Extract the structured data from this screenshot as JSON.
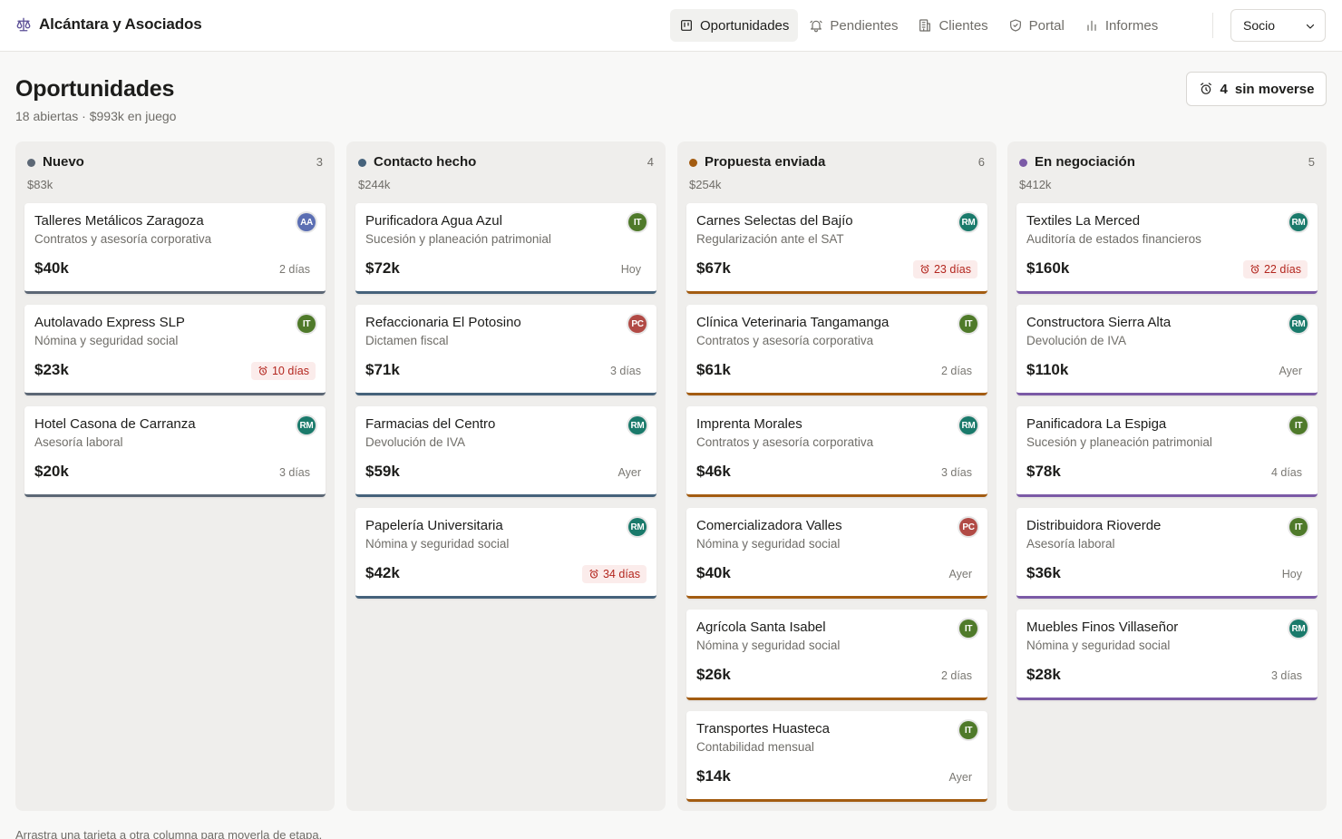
{
  "brand": {
    "name": "Alcántara y Asociados",
    "icon": "scales-icon"
  },
  "nav": [
    {
      "label": "Oportunidades",
      "icon": "kanban-icon",
      "active": true
    },
    {
      "label": "Pendientes",
      "icon": "bell-icon",
      "active": false
    },
    {
      "label": "Clientes",
      "icon": "building-icon",
      "active": false
    },
    {
      "label": "Portal",
      "icon": "shield-icon",
      "active": false
    },
    {
      "label": "Informes",
      "icon": "bar-chart-icon",
      "active": false
    }
  ],
  "role_select": {
    "value": "Socio"
  },
  "page": {
    "title": "Oportunidades",
    "subtitle": "18 abiertas · $993k en juego",
    "stale_button": {
      "count": "4",
      "label": "sin moverse"
    }
  },
  "colors": {
    "nuevo": "#5c6775",
    "contacto": "#45627b",
    "propuesta": "#a35c11",
    "negociacion": "#7b5aa6",
    "stale_bg": "#fbeceb",
    "stale_text": "#b3261e"
  },
  "avatars": {
    "AA": "#5b6eb3",
    "IT": "#4f7a2a",
    "PC": "#b14a45",
    "RM": "#1a7a6b"
  },
  "columns": [
    {
      "title": "Nuevo",
      "count": "3",
      "total": "$83k",
      "color": "#5c6775",
      "cards": [
        {
          "name": "Talleres Metálicos Zaragoza",
          "service": "Contratos y asesoría corporativa",
          "amount": "$40k",
          "age": "2 días",
          "stale": false,
          "owner": "AA"
        },
        {
          "name": "Autolavado Express SLP",
          "service": "Nómina y seguridad social",
          "amount": "$23k",
          "age": "10 días",
          "stale": true,
          "owner": "IT"
        },
        {
          "name": "Hotel Casona de Carranza",
          "service": "Asesoría laboral",
          "amount": "$20k",
          "age": "3 días",
          "stale": false,
          "owner": "RM"
        }
      ]
    },
    {
      "title": "Contacto hecho",
      "count": "4",
      "total": "$244k",
      "color": "#45627b",
      "cards": [
        {
          "name": "Purificadora Agua Azul",
          "service": "Sucesión y planeación patrimonial",
          "amount": "$72k",
          "age": "Hoy",
          "stale": false,
          "owner": "IT"
        },
        {
          "name": "Refaccionaria El Potosino",
          "service": "Dictamen fiscal",
          "amount": "$71k",
          "age": "3 días",
          "stale": false,
          "owner": "PC"
        },
        {
          "name": "Farmacias del Centro",
          "service": "Devolución de IVA",
          "amount": "$59k",
          "age": "Ayer",
          "stale": false,
          "owner": "RM"
        },
        {
          "name": "Papelería Universitaria",
          "service": "Nómina y seguridad social",
          "amount": "$42k",
          "age": "34 días",
          "stale": true,
          "owner": "RM"
        }
      ]
    },
    {
      "title": "Propuesta enviada",
      "count": "6",
      "total": "$254k",
      "color": "#a35c11",
      "cards": [
        {
          "name": "Carnes Selectas del Bajío",
          "service": "Regularización ante el SAT",
          "amount": "$67k",
          "age": "23 días",
          "stale": true,
          "owner": "RM"
        },
        {
          "name": "Clínica Veterinaria Tangamanga",
          "service": "Contratos y asesoría corporativa",
          "amount": "$61k",
          "age": "2 días",
          "stale": false,
          "owner": "IT"
        },
        {
          "name": "Imprenta Morales",
          "service": "Contratos y asesoría corporativa",
          "amount": "$46k",
          "age": "3 días",
          "stale": false,
          "owner": "RM"
        },
        {
          "name": "Comercializadora Valles",
          "service": "Nómina y seguridad social",
          "amount": "$40k",
          "age": "Ayer",
          "stale": false,
          "owner": "PC"
        },
        {
          "name": "Agrícola Santa Isabel",
          "service": "Nómina y seguridad social",
          "amount": "$26k",
          "age": "2 días",
          "stale": false,
          "owner": "IT"
        },
        {
          "name": "Transportes Huasteca",
          "service": "Contabilidad mensual",
          "amount": "$14k",
          "age": "Ayer",
          "stale": false,
          "owner": "IT"
        }
      ]
    },
    {
      "title": "En negociación",
      "count": "5",
      "total": "$412k",
      "color": "#7b5aa6",
      "cards": [
        {
          "name": "Textiles La Merced",
          "service": "Auditoría de estados financieros",
          "amount": "$160k",
          "age": "22 días",
          "stale": true,
          "owner": "RM"
        },
        {
          "name": "Constructora Sierra Alta",
          "service": "Devolución de IVA",
          "amount": "$110k",
          "age": "Ayer",
          "stale": false,
          "owner": "RM"
        },
        {
          "name": "Panificadora La Espiga",
          "service": "Sucesión y planeación patrimonial",
          "amount": "$78k",
          "age": "4 días",
          "stale": false,
          "owner": "IT"
        },
        {
          "name": "Distribuidora Rioverde",
          "service": "Asesoría laboral",
          "amount": "$36k",
          "age": "Hoy",
          "stale": false,
          "owner": "IT"
        },
        {
          "name": "Muebles Finos Villaseñor",
          "service": "Nómina y seguridad social",
          "amount": "$28k",
          "age": "3 días",
          "stale": false,
          "owner": "RM"
        }
      ]
    }
  ],
  "footnote": "Arrastra una tarjeta a otra columna para moverla de etapa."
}
